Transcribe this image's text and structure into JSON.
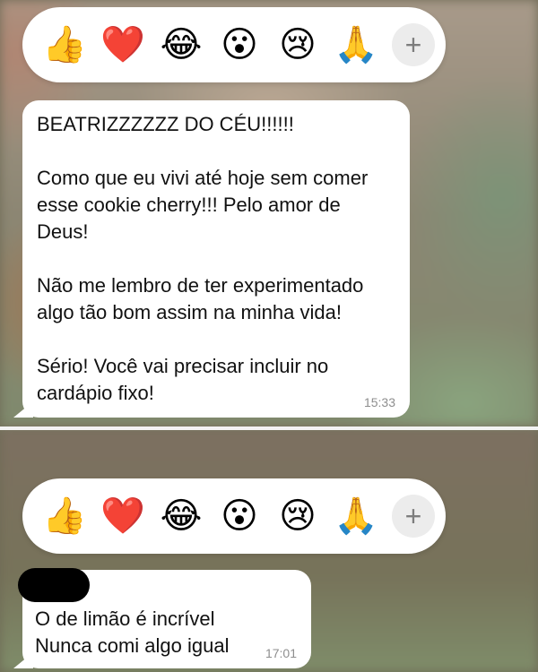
{
  "reactions": [
    {
      "emoji": "👍",
      "name": "thumbs-up"
    },
    {
      "emoji": "❤️",
      "name": "heart"
    },
    {
      "emoji": "😂",
      "name": "tears-of-joy"
    },
    {
      "emoji": "😮",
      "name": "surprised"
    },
    {
      "emoji": "😢",
      "name": "crying"
    },
    {
      "emoji": "🙏",
      "name": "praying-hands"
    }
  ],
  "plus_label": "+",
  "message1": {
    "lines": [
      "BEATRIZZZZZZ DO CÉU!!!!!!",
      "",
      "Como que eu vivi até hoje sem comer",
      "esse cookie cherry!!! Pelo amor de",
      "Deus!",
      "",
      "Não me lembro de ter experimentado",
      "algo tão bom assim na minha vida!",
      "",
      "Sério! Você vai precisar incluir no",
      "cardápio fixo!"
    ],
    "time": "15:33"
  },
  "message2": {
    "lines": [
      "O de limão é incrível",
      "Nunca comi algo igual"
    ],
    "time": "17:01"
  }
}
